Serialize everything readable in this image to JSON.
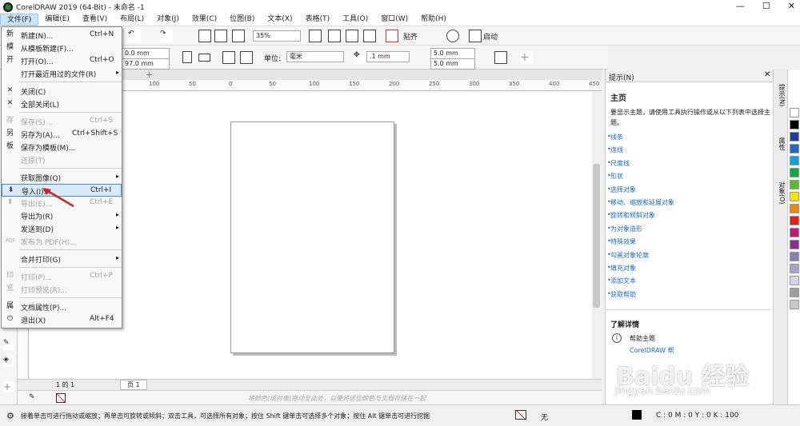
{
  "window": {
    "title": "CorelDRAW 2019 (64-Bit) - 未命名 -1",
    "min": "—",
    "max": "☐",
    "close": "✕"
  },
  "menubar": [
    "文件(F)",
    "编辑(E)",
    "查看(V)",
    "布局(L)",
    "对象(J)",
    "效果(C)",
    "位图(B)",
    "文本(X)",
    "表格(T)",
    "工具(O)",
    "窗口(W)",
    "帮助(H)"
  ],
  "toolbar1": {
    "zoom": "35%",
    "snap_label": "贴齐",
    "launch_label": "启动"
  },
  "toolbar2": {
    "width_value": "0.0 mm",
    "height_value": "97.0 mm",
    "unit_label": "单位:",
    "unit_value": "毫米",
    "nudge_value": ".1 mm",
    "dup_x": "5.0 mm",
    "dup_y": "5.0 mm"
  },
  "ruler_labels": [
    "100",
    "50",
    "0",
    "50",
    "100",
    "150",
    "200",
    "250",
    "300",
    "350",
    "400",
    "450"
  ],
  "file_menu": {
    "items": [
      {
        "label": "新建(N)...",
        "shortcut": "Ctrl+N",
        "icon": "新",
        "disabled": false
      },
      {
        "label": "从模板新建(F)...",
        "shortcut": "",
        "icon": "模",
        "disabled": false
      },
      {
        "label": "打开(O)...",
        "shortcut": "Ctrl+O",
        "icon": "开",
        "disabled": false
      },
      {
        "label": "打开最近用过的文件(R)",
        "shortcut": "",
        "icon": "",
        "disabled": false,
        "submenu": true
      },
      {
        "label": "关闭(C)",
        "shortcut": "",
        "icon": "✕",
        "disabled": false
      },
      {
        "label": "全部关闭(L)",
        "shortcut": "",
        "icon": "✕",
        "disabled": false
      },
      {
        "label": "保存(S)...",
        "shortcut": "Ctrl+S",
        "icon": "存",
        "disabled": true
      },
      {
        "label": "另存为(A)...",
        "shortcut": "Ctrl+Shift+S",
        "icon": "另",
        "disabled": false
      },
      {
        "label": "保存为模板(M)...",
        "shortcut": "",
        "icon": "板",
        "disabled": false
      },
      {
        "label": "还原(T)",
        "shortcut": "",
        "icon": "",
        "disabled": true
      },
      {
        "label": "获取图像(Q)",
        "shortcut": "",
        "icon": "",
        "disabled": false,
        "submenu": true
      },
      {
        "label": "导入(I)...",
        "shortcut": "Ctrl+I",
        "icon": "⬇",
        "disabled": false,
        "highlight": true
      },
      {
        "label": "导出(E)...",
        "shortcut": "Ctrl+E",
        "icon": "⬆",
        "disabled": true
      },
      {
        "label": "导出为(R)",
        "shortcut": "",
        "icon": "",
        "disabled": false,
        "submenu": true
      },
      {
        "label": "发送到(D)",
        "shortcut": "",
        "icon": "",
        "disabled": false,
        "submenu": true
      },
      {
        "label": "发布为 PDF(H)...",
        "shortcut": "",
        "icon": "PDF",
        "disabled": true
      },
      {
        "label": "合并打印(G)",
        "shortcut": "",
        "icon": "",
        "disabled": false,
        "submenu": true
      },
      {
        "label": "打印(P)...",
        "shortcut": "Ctrl+P",
        "icon": "印",
        "disabled": true
      },
      {
        "label": "打印预览(R)...",
        "shortcut": "",
        "icon": "览",
        "disabled": true
      },
      {
        "label": "文档属性(P)...",
        "shortcut": "",
        "icon": "属",
        "disabled": false
      },
      {
        "label": "退出(X)",
        "shortcut": "Alt+F4",
        "icon": "⏻",
        "disabled": false
      }
    ]
  },
  "hints_docker": {
    "tab_label": "提示(N)",
    "heading": "主页",
    "description": "要显示主题，请使用工具执行操作或从以下列表中选择主题。",
    "links": [
      "线条",
      "连线",
      "尺度线",
      "形状",
      "选择对象",
      "移动、缩放和延展对象",
      "旋转和倾斜对象",
      "为对象造形",
      "特殊效果",
      "勾画对象轮廓",
      "填充对象",
      "添加文本",
      "获取帮助"
    ],
    "learn_more": "了解详情",
    "help_topic": "帮助主题",
    "help_link": "CorelDRAW 帮"
  },
  "docker_tabs": [
    "提示(N)",
    "属性",
    "对象(O)"
  ],
  "page_tab": "页 1",
  "page_nav": "1 的 1",
  "colorbar_hint": "将颜色(或对象)拖动至此处，以便将这些颜色与文档存储在一起",
  "status": {
    "message": "接着单击可进行拖动或缩放；再单击可旋转或倾斜；双击工具，可选择所有对象；按住 Shift 键单击可选择多个对象；按住 Alt 键单击可进行挖掘",
    "fill_label": "无",
    "outline_value": "C : 0 M : 0 Y : 0 K : 100"
  },
  "palette_colors": [
    "#ffffff",
    "#000000",
    "#1d3f9e",
    "#2268c5",
    "#14a0d8",
    "#11a543",
    "#56bd2d",
    "#f4e500",
    "#e98a12",
    "#e2211c",
    "#c0187a",
    "#8d2d8d",
    "#8a7fb3",
    "#a5a1c7",
    "#d7d3e6",
    "#9e9e9e",
    "#c8c8c8"
  ],
  "watermark": {
    "logo": "Baidu 经验",
    "url": "jingyan.baidu.com"
  }
}
